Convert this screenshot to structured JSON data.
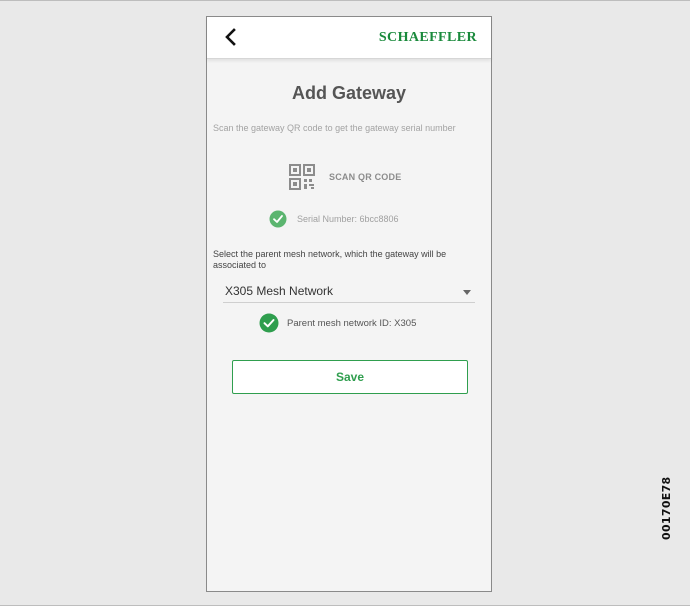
{
  "appbar": {
    "back_icon": "chevron-left-icon",
    "logo_text": "SCHAEFFLER",
    "logo_color": "#1a8a3c"
  },
  "page": {
    "title": "Add Gateway",
    "scan_hint": "Scan the gateway QR code to get the gateway serial number",
    "scan_button_label": "SCAN QR CODE",
    "scan_icon": "qr-code-icon",
    "serial_number_text": "Serial Number: 6bcc8806",
    "serial_status_icon": "check-circle-icon",
    "select_parent_text": "Select the parent mesh network, which the gateway will be associated to",
    "mesh_network_selected": "X305 Mesh Network",
    "parent_network_id_text": "Parent mesh network ID: X305",
    "parent_status_icon": "check-circle-icon",
    "save_label": "Save",
    "accent_color": "#2f9e4e"
  },
  "figure_code": "00170E78"
}
